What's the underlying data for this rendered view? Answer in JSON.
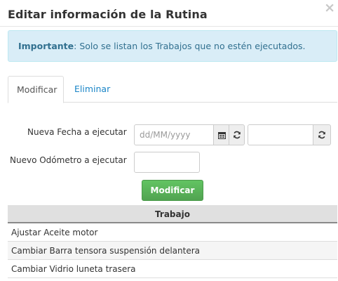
{
  "modal": {
    "title": "Editar información de la Rutina",
    "close_glyph": "×"
  },
  "alert": {
    "strong": "Importante",
    "text": ": Solo se listan los Trabajos que no estén ejecutados."
  },
  "tabs": [
    {
      "label": "Modificar",
      "active": true
    },
    {
      "label": "Eliminar",
      "active": false
    }
  ],
  "form": {
    "date_label": "Nueva Fecha a ejecutar",
    "date_placeholder": "dd/MM/yyyy",
    "date_value": "",
    "time_value": "",
    "odometer_label": "Nuevo Odómetro a ejecutar",
    "odometer_value": "",
    "icons": [
      "calendar-icon",
      "refresh-icon",
      "refresh-icon"
    ],
    "submit_label": "Modificar"
  },
  "table": {
    "header": "Trabajo",
    "rows": [
      "Ajustar Aceite motor",
      "Cambiar Barra tensora suspensión delantera",
      "Cambiar Vidrio luneta trasera"
    ]
  },
  "colors": {
    "alert_bg": "#d9edf7",
    "alert_text": "#31708f",
    "link": "#1a85c7",
    "success": "#5cb85c"
  }
}
